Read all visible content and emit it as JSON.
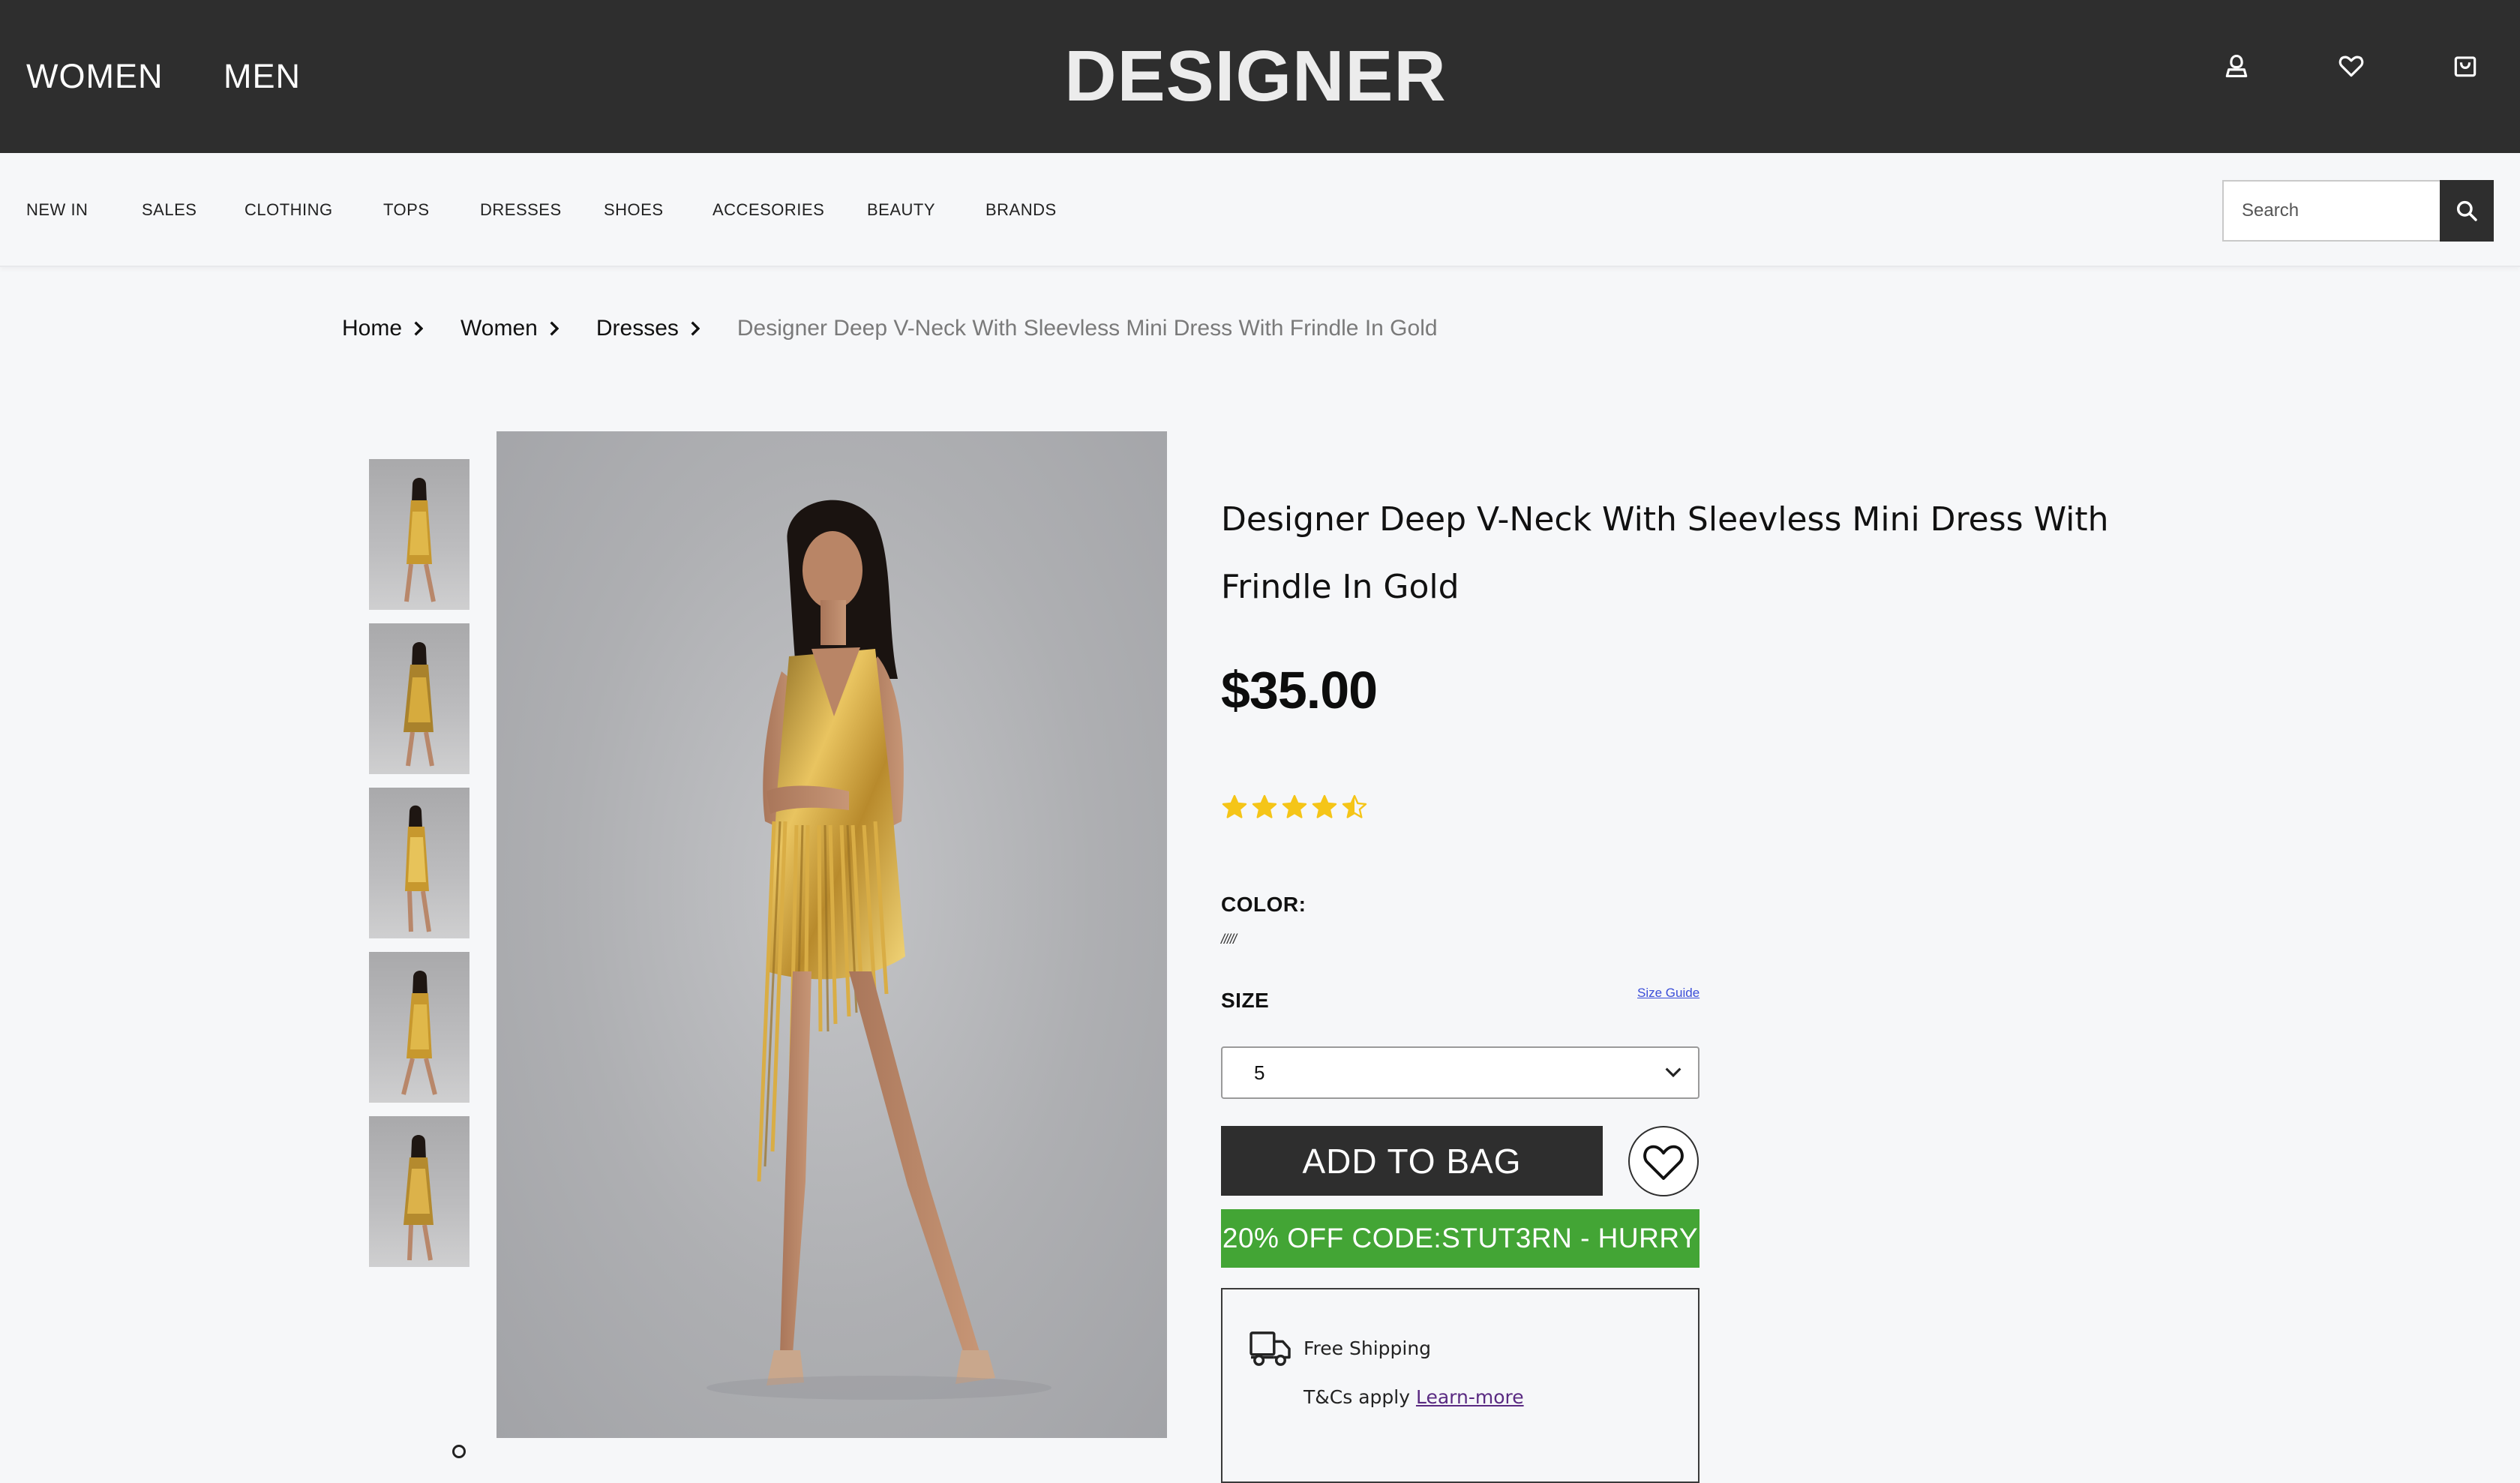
{
  "header": {
    "nav": [
      "WOMEN",
      "MEN"
    ],
    "brand": "DESIGNER",
    "icons": [
      "account-icon",
      "heart-icon",
      "shopping-bag-icon"
    ],
    "background": "#2e2e2e"
  },
  "categories": [
    "NEW IN",
    "SALES",
    "CLOTHING",
    "TOPS",
    "DRESSES",
    "SHOES",
    "ACCESORIES",
    "BEAUTY",
    "BRANDS"
  ],
  "search": {
    "placeholder": "Search",
    "icon": "search-icon"
  },
  "breadcrumb": {
    "items": [
      "Home",
      "Women",
      "Dresses"
    ],
    "current": "Designer Deep V-Neck With Sleevless Mini Dress With Frindle In Gold"
  },
  "product": {
    "title": "Designer Deep V-Neck With Sleevless Mini Dress With Frindle In Gold",
    "price": "$35.00",
    "rating": 4.5,
    "rating_max": 5,
    "star_color": "#f5c518",
    "color_label": "COLOR:",
    "color_value": "/////",
    "size_label": "SIZE",
    "size_guide": "Size Guide",
    "selected_size": "5",
    "add_to_bag": "ADD TO BAG",
    "promo": "20% OFF CODE:STUT3RN - HURRY",
    "promo_color": "#43a535",
    "shipping_title": "Free Shipping",
    "shipping_note": "T&Cs apply",
    "shipping_link": "Learn-more",
    "thumbnail_count": 5
  }
}
